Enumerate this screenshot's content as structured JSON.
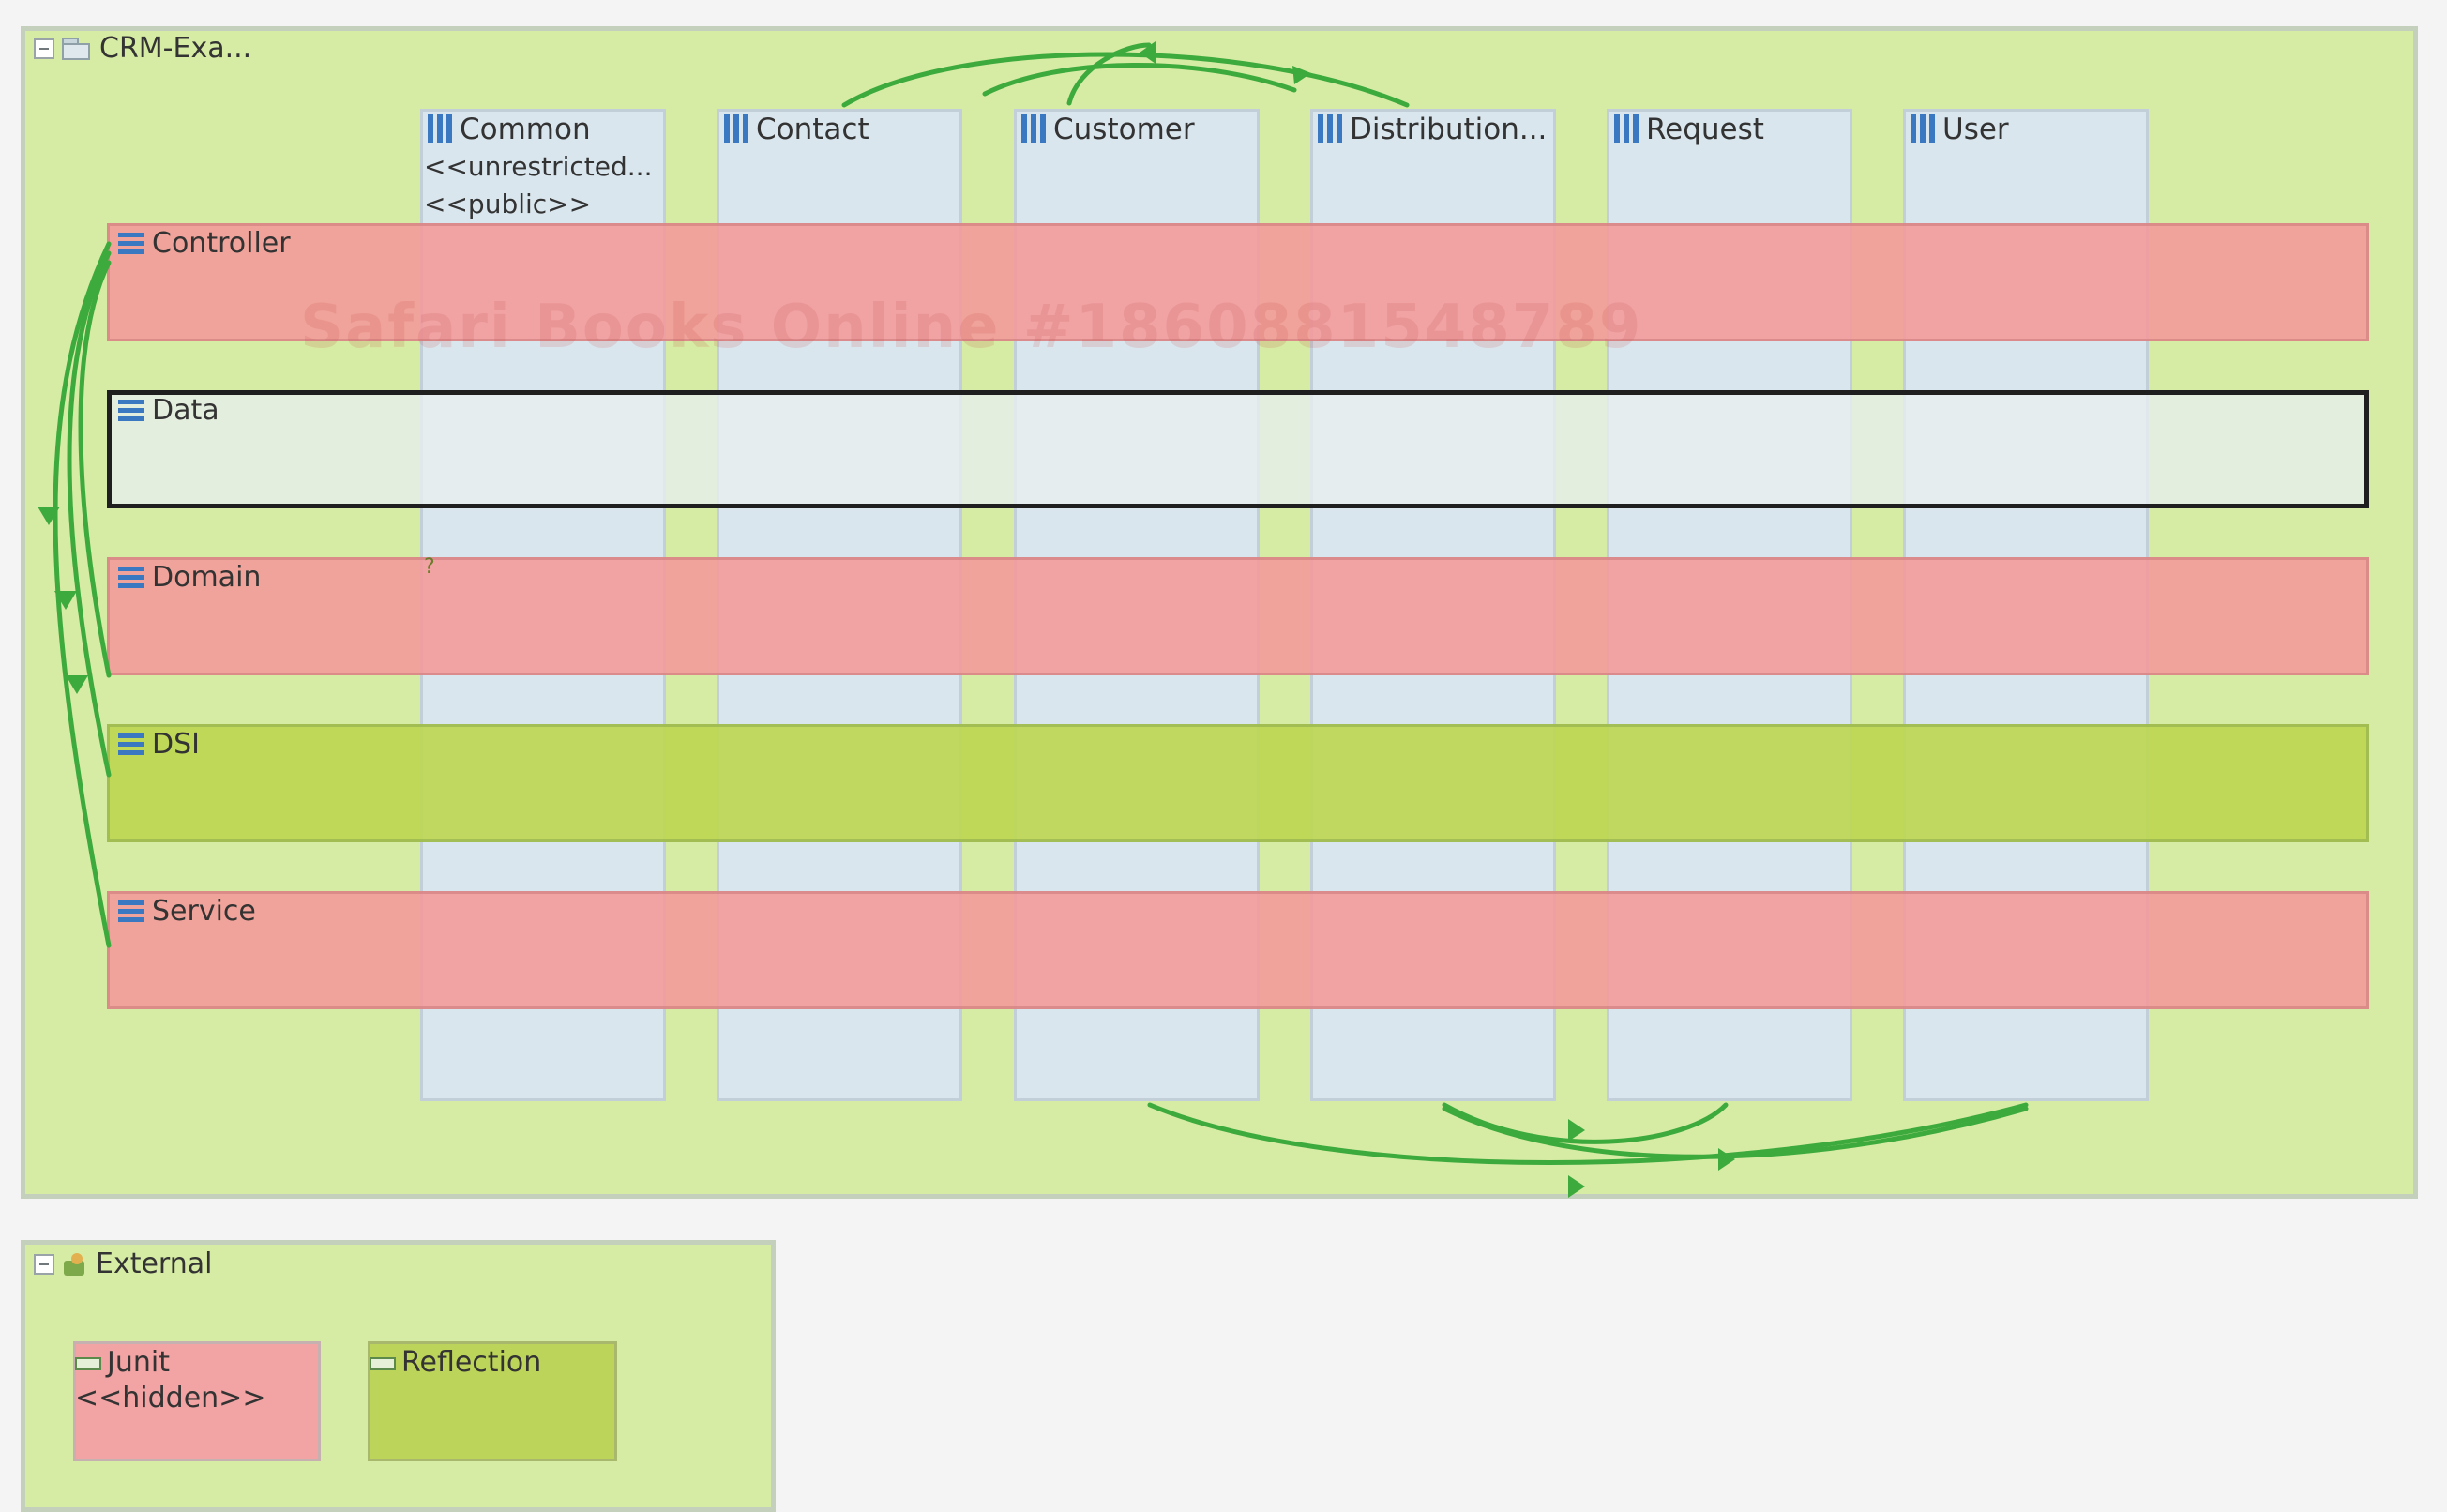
{
  "containers": {
    "crm": {
      "title": "CRM-Exa..."
    },
    "external": {
      "title": "External"
    }
  },
  "slices": [
    {
      "name": "Common",
      "sub1": "<<unrestricted...",
      "sub2": "<<public>>"
    },
    {
      "name": "Contact"
    },
    {
      "name": "Customer"
    },
    {
      "name": "Distribution..."
    },
    {
      "name": "Request"
    },
    {
      "name": "User"
    }
  ],
  "layers": [
    {
      "name": "Controller",
      "status": "violation",
      "color": "#f49898"
    },
    {
      "name": "Data",
      "status": "selected",
      "color": "#e8eef0"
    },
    {
      "name": "Domain",
      "status": "violation",
      "color": "#f49898"
    },
    {
      "name": "DSI",
      "status": "ok",
      "color": "#bcd650"
    },
    {
      "name": "Service",
      "status": "violation",
      "color": "#f49898"
    }
  ],
  "external_items": [
    {
      "name": "Junit",
      "stereotype": "<<hidden>>",
      "status": "violation"
    },
    {
      "name": "Reflection",
      "status": "ok"
    }
  ],
  "marker": "?",
  "watermark": "Safari Books Online #1860881548789",
  "colors": {
    "container_bg": "#d6eba3",
    "slice_bg": "#dae6ee",
    "violation": "#f49898",
    "ok": "#bcd650",
    "dependency_arrow": "#3daa3d",
    "selected_border": "#1f1f1f"
  },
  "icons": {
    "container": "folder-icon",
    "external": "external-icon",
    "slice": "slice-icon",
    "layer": "layer-icon",
    "library": "library-icon"
  }
}
